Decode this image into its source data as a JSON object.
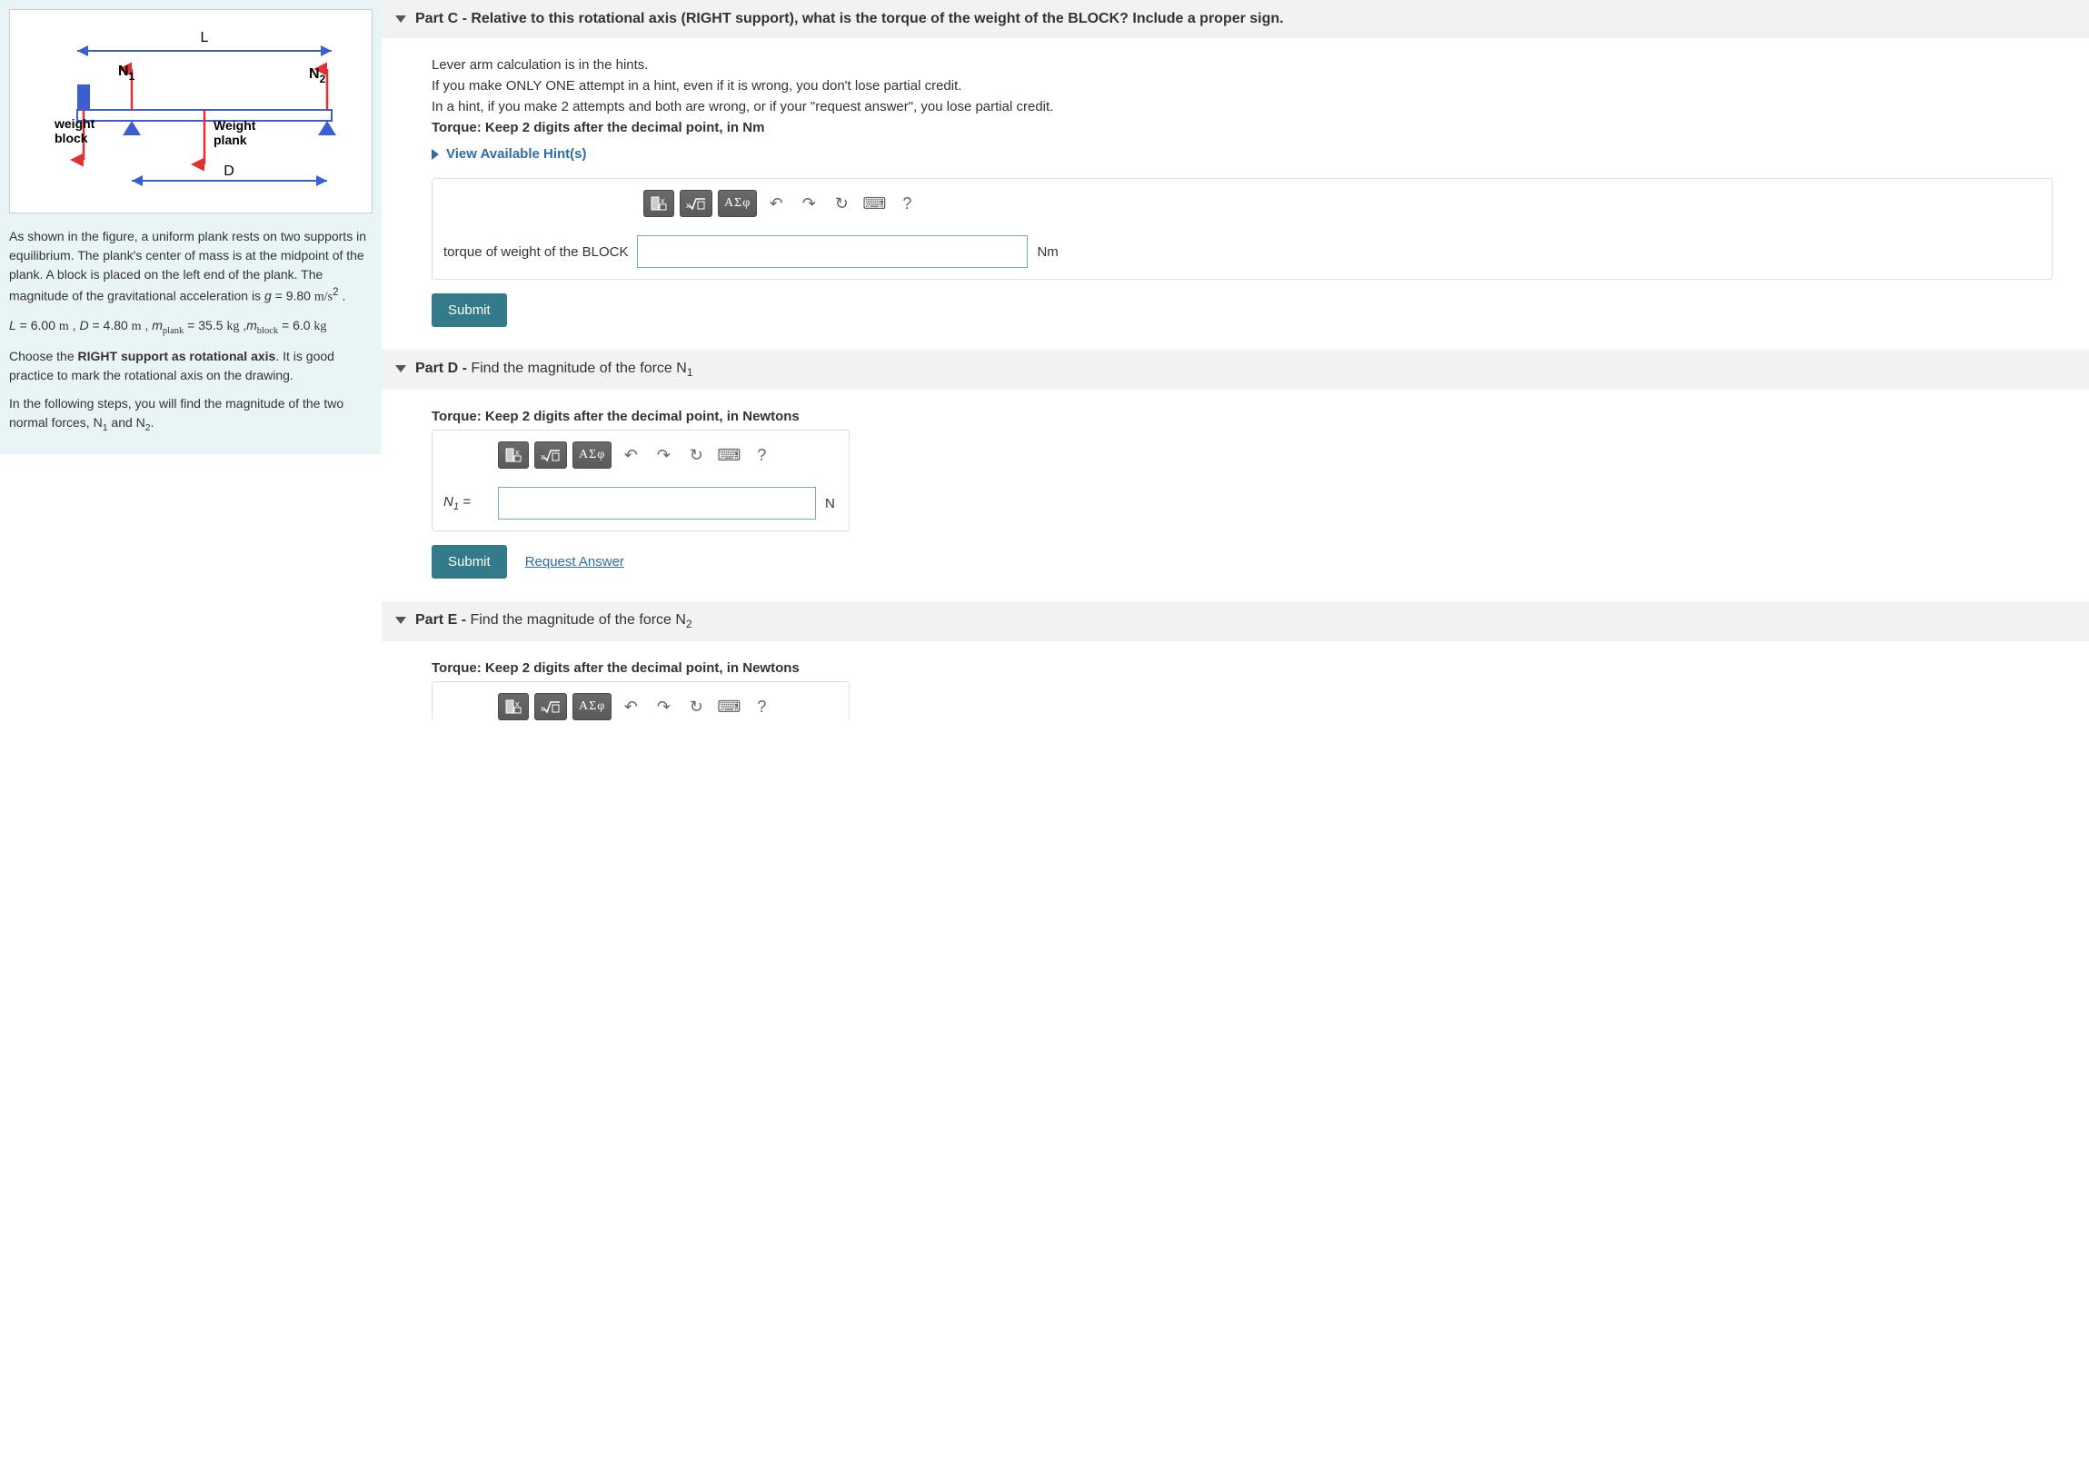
{
  "figure": {
    "L_label": "L",
    "D_label": "D",
    "N1_label": "N",
    "N1_sub": "1",
    "N2_label": "N",
    "N2_sub": "2",
    "weight_block_l1": "weight",
    "weight_block_l2": "block",
    "weight_plank_l1": "Weight",
    "weight_plank_l2": "plank"
  },
  "sidebar": {
    "p1a": "As shown in the figure, a uniform plank rests on two supports in equilibrium. The plank's center of mass is at the midpoint of the plank. A block is placed on the left end of the plank. The magnitude of the gravitational acceleration is ",
    "p1b": "g",
    "p1c": " = 9.80 ",
    "p1d": "m/s",
    "p1e": "2",
    "p1f": " .",
    "p2a": "L",
    "p2b": " = 6.00 ",
    "p2c": "m",
    "p2d": " ,  ",
    "p2e": "D",
    "p2f": " = 4.80 ",
    "p2g": "m",
    "p2h": " , ",
    "p2i": "m",
    "p2j": "plank",
    "p2k": " = 35.5 ",
    "p2l": "kg",
    "p2m": " ,",
    "p2n": "m",
    "p2o": "block",
    "p2p": " = 6.0 ",
    "p2q": "kg",
    "p3a": "Choose the ",
    "p3b": "RIGHT support as rotational axis",
    "p3c": ". It is good practice to mark the rotational axis on the drawing.",
    "p4a": "In the following steps, you will find the magnitude of the two normal forces, N",
    "p4b": "1",
    "p4c": " and N",
    "p4d": "2",
    "p4e": "."
  },
  "partC": {
    "title_label": "Part C - ",
    "title_text": "Relative to this  rotational axis (RIGHT support), what is the torque of the weight of the BLOCK?  Include a proper sign.",
    "line1": "Lever arm calculation is in the hints.",
    "line2": "If you make ONLY ONE attempt in a hint, even if it is wrong, you don't lose partial credit.",
    "line3": "In a hint, if you make 2 attempts and both are wrong, or if your \"request answer\", you lose partial credit.",
    "line4": "Torque: Keep 2 digits after the decimal point, in Nm",
    "hints": "View Available Hint(s)",
    "input_label": "torque of weight of the BLOCK",
    "unit": "Nm",
    "submit": "Submit"
  },
  "partD": {
    "title_label": "Part D - ",
    "title_text_a": "Find the magnitude of the force N",
    "title_text_b": "1",
    "line1": "Torque: Keep 2 digits after the decimal point, in Newtons",
    "input_label_a": "N",
    "input_label_b": "1",
    "input_label_c": " = ",
    "unit": "N",
    "submit": "Submit",
    "request": "Request Answer"
  },
  "partE": {
    "title_label": "Part E - ",
    "title_text_a": "Find the magnitude of the force N",
    "title_text_b": "2",
    "line1": "Torque: Keep 2 digits after the decimal point, in Newtons"
  },
  "toolbar": {
    "greek": "ΑΣφ",
    "undo": "↶",
    "redo": "↷",
    "reset": "↻",
    "keyboard": "⌨",
    "help": "?"
  }
}
